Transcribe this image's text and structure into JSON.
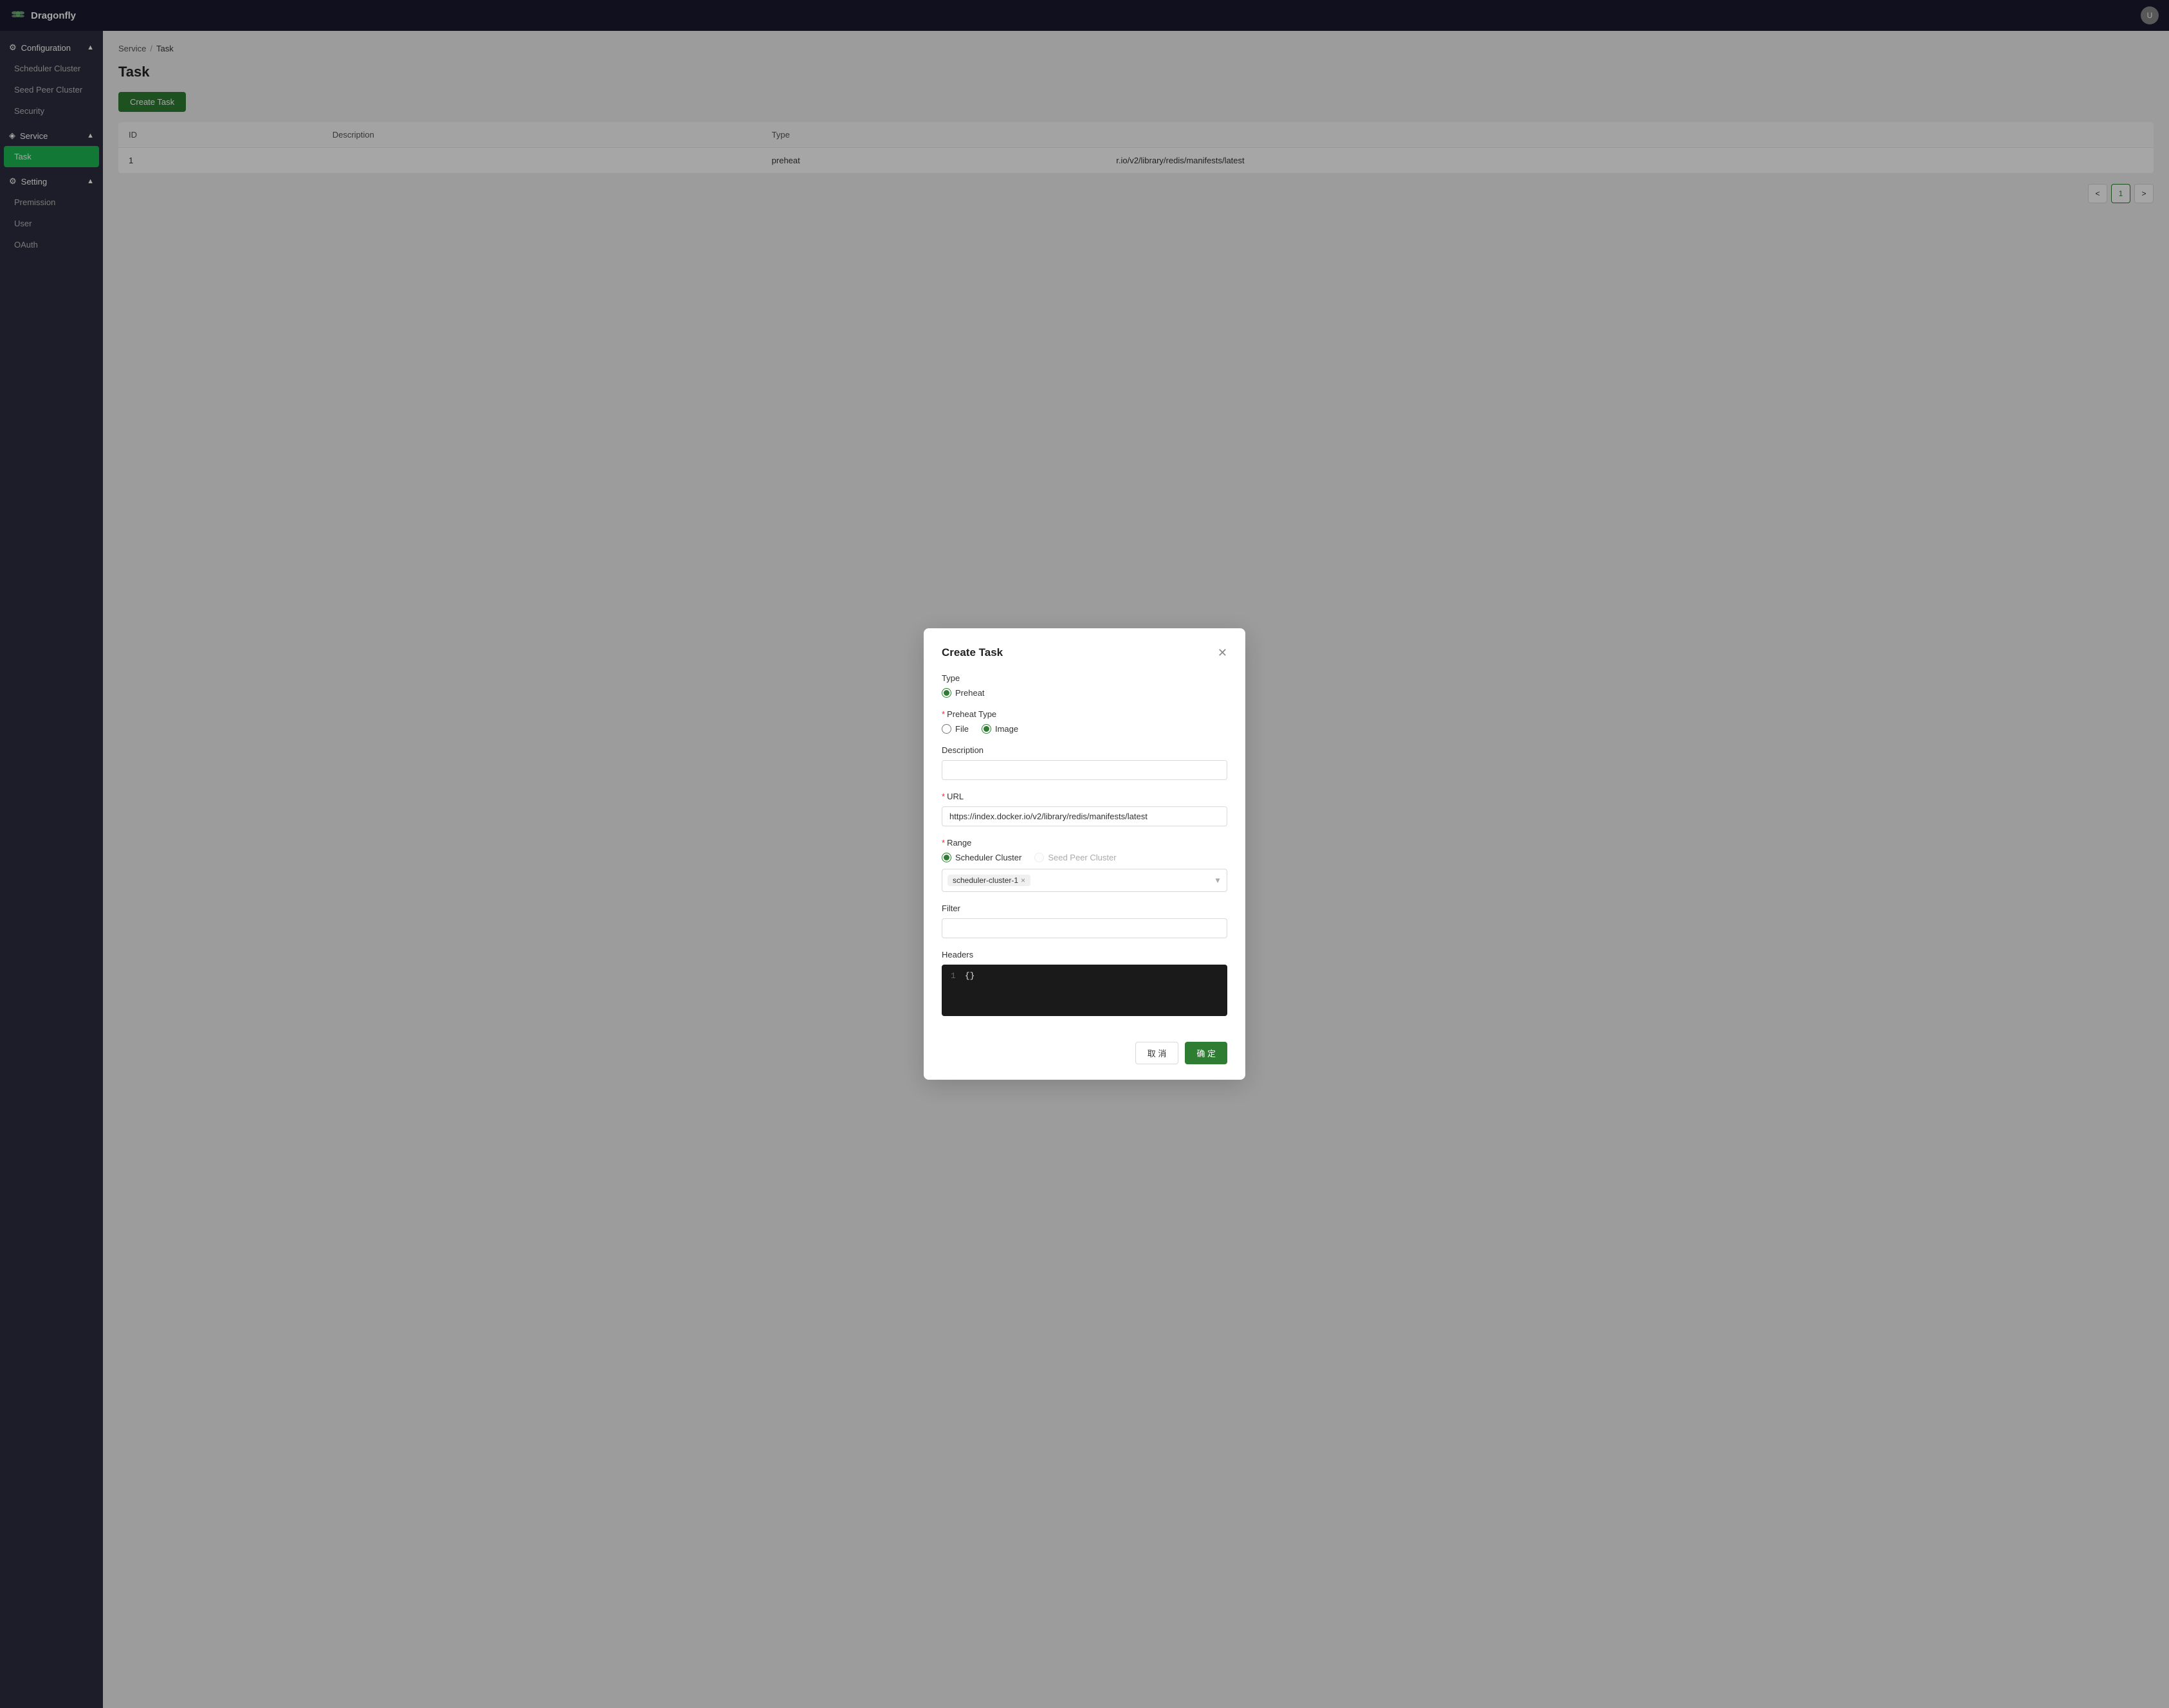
{
  "app": {
    "name": "Dragonfly"
  },
  "topnav": {
    "logo_text": "Dragonfly",
    "avatar_text": "U"
  },
  "sidebar": {
    "configuration_label": "Configuration",
    "setting_label": "Setting",
    "items": {
      "scheduler_cluster": "Scheduler Cluster",
      "seed_peer_cluster": "Seed Peer Cluster",
      "security": "Security",
      "service": "Service",
      "task": "Task",
      "premission": "Premission",
      "user": "User",
      "oauth": "OAuth"
    }
  },
  "breadcrumb": {
    "service": "Service",
    "separator": "/",
    "current": "Task"
  },
  "page": {
    "title": "Task",
    "create_btn": "Create Task"
  },
  "table": {
    "columns": [
      "ID",
      "Description",
      "Type"
    ],
    "rows": [
      {
        "id": "1",
        "description": "",
        "type": "preheat",
        "url": "r.io/v2/library/redis/manifests/latest"
      }
    ]
  },
  "pagination": {
    "prev": "<",
    "next": ">",
    "current_page": "1"
  },
  "modal": {
    "title": "Create Task",
    "type_label": "Type",
    "preheat_option": "Preheat",
    "preheat_type_label": "Preheat Type",
    "file_option": "File",
    "image_option": "Image",
    "description_label": "Description",
    "description_placeholder": "",
    "url_label": "URL",
    "url_value": "https://index.docker.io/v2/library/redis/manifests/latest",
    "range_label": "Range",
    "scheduler_cluster_option": "Scheduler Cluster",
    "seed_peer_cluster_option": "Seed Peer Cluster",
    "tag_value": "scheduler-cluster-1",
    "tag_remove": "×",
    "filter_label": "Filter",
    "filter_placeholder": "",
    "headers_label": "Headers",
    "headers_line_number": "1",
    "headers_content": "{}",
    "cancel_btn": "取 消",
    "confirm_btn": "确 定"
  }
}
